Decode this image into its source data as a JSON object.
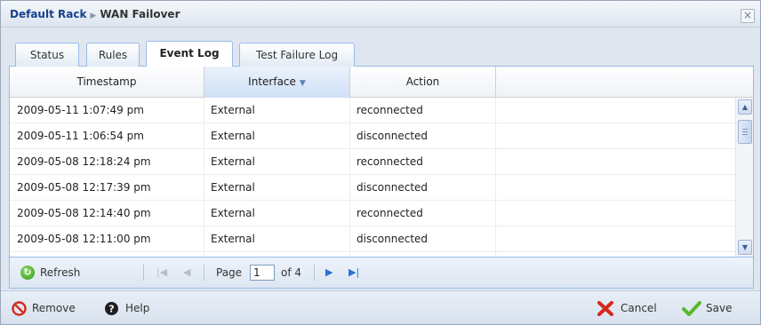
{
  "titlebar": {
    "breadcrumb_root": "Default Rack",
    "breadcrumb_sep": "▶",
    "breadcrumb_current": "WAN Failover",
    "close_glyph": "×"
  },
  "tabs": [
    {
      "label": "Status",
      "active": false
    },
    {
      "label": "Rules",
      "active": false
    },
    {
      "label": "Event Log",
      "active": true
    },
    {
      "label": "Test Failure Log",
      "active": false
    }
  ],
  "grid": {
    "columns": [
      {
        "label": "Timestamp",
        "sorted": false
      },
      {
        "label": "Interface",
        "sorted": true,
        "sort_glyph": "▼"
      },
      {
        "label": "Action",
        "sorted": false
      }
    ],
    "rows": [
      {
        "timestamp": "2009-05-11 1:07:49 pm",
        "interface": "External",
        "action": "reconnected"
      },
      {
        "timestamp": "2009-05-11 1:06:54 pm",
        "interface": "External",
        "action": "disconnected"
      },
      {
        "timestamp": "2009-05-08 12:18:24 pm",
        "interface": "External",
        "action": "reconnected"
      },
      {
        "timestamp": "2009-05-08 12:17:39 pm",
        "interface": "External",
        "action": "disconnected"
      },
      {
        "timestamp": "2009-05-08 12:14:40 pm",
        "interface": "External",
        "action": "reconnected"
      },
      {
        "timestamp": "2009-05-08 12:11:00 pm",
        "interface": "External",
        "action": "disconnected"
      }
    ]
  },
  "paging": {
    "refresh_label": "Refresh",
    "page_label": "Page",
    "page_value": "1",
    "of_label": "of 4",
    "first_glyph": "|◀",
    "prev_glyph": "◀",
    "next_glyph": "▶",
    "last_glyph": "▶|"
  },
  "footer": {
    "remove_label": "Remove",
    "help_label": "Help",
    "cancel_label": "Cancel",
    "save_label": "Save",
    "help_glyph": "?"
  },
  "colors": {
    "header_text": "#15428b",
    "border": "#99bbe8",
    "remove_icon": "#d42a1c",
    "cancel_icon": "#d42a1c",
    "save_icon": "#58b82a",
    "nav_enabled": "#2a6fd6"
  },
  "icons": {
    "close": "close-icon",
    "refresh": "refresh-icon",
    "remove": "remove-icon",
    "help": "help-icon",
    "cancel": "cancel-icon",
    "save": "save-icon",
    "sort": "sort-desc-icon"
  }
}
